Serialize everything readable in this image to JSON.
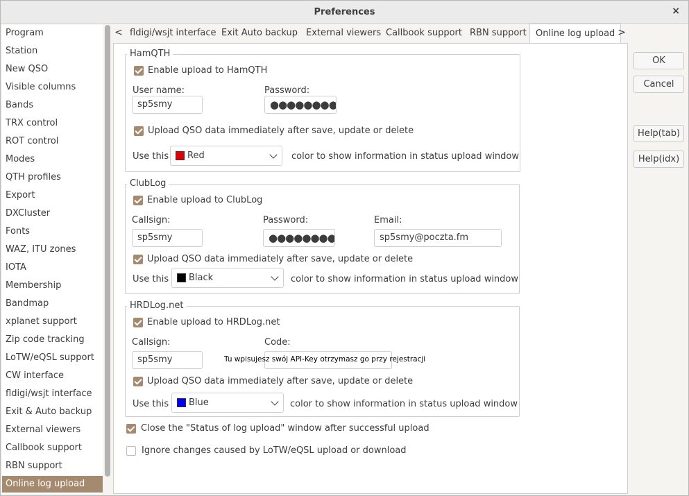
{
  "window": {
    "title": "Preferences",
    "close_glyph": "×"
  },
  "sidebar": {
    "items": [
      {
        "label": "Program"
      },
      {
        "label": "Station"
      },
      {
        "label": "New QSO"
      },
      {
        "label": "Visible columns"
      },
      {
        "label": "Bands"
      },
      {
        "label": "TRX control"
      },
      {
        "label": "ROT control"
      },
      {
        "label": "Modes"
      },
      {
        "label": "QTH profiles"
      },
      {
        "label": "Export"
      },
      {
        "label": "DXCluster"
      },
      {
        "label": "Fonts"
      },
      {
        "label": "WAZ, ITU zones"
      },
      {
        "label": "IOTA"
      },
      {
        "label": "Membership"
      },
      {
        "label": "Bandmap"
      },
      {
        "label": "xplanet support"
      },
      {
        "label": "Zip code tracking"
      },
      {
        "label": "LoTW/eQSL support"
      },
      {
        "label": "CW interface"
      },
      {
        "label": "fldigi/wsjt interface"
      },
      {
        "label": "Exit & Auto backup"
      },
      {
        "label": "External viewers"
      },
      {
        "label": "Callbook support"
      },
      {
        "label": "RBN support"
      },
      {
        "label": "Online log upload"
      }
    ],
    "selected": "Online log upload"
  },
  "tabs": {
    "left_arrow": "<",
    "right_arrow": ">",
    "items": [
      "fldigi/wsjt interface",
      "Exit  Auto backup",
      "External viewers",
      "Callbook support",
      "RBN support",
      "Online log upload"
    ],
    "active": "Online log upload"
  },
  "hamqth": {
    "title": "HamQTH",
    "enable_label": "Enable upload to HamQTH",
    "enable_checked": true,
    "username_label": "User name:",
    "username_value": "sp5smy",
    "password_label": "Password:",
    "password_value": "●●●●●●●●",
    "immediate_label": "Upload QSO data immediately after save, update or delete",
    "immediate_checked": true,
    "use_this": "Use this",
    "color_name": "Red",
    "color_hex": "#e00000",
    "color_suffix": "color to show information in status upload window"
  },
  "clublog": {
    "title": "ClubLog",
    "enable_label": "Enable upload to ClubLog",
    "enable_checked": true,
    "callsign_label": "Callsign:",
    "callsign_value": "sp5smy",
    "password_label": "Password:",
    "password_value": "●●●●●●●●",
    "email_label": "Email:",
    "email_value": "sp5smy@poczta.fm",
    "immediate_label": "Upload QSO data immediately after save, update or delete",
    "immediate_checked": true,
    "use_this": "Use this",
    "color_name": "Black",
    "color_hex": "#000000",
    "color_suffix": "color to show information in status upload window"
  },
  "hrdlog": {
    "title": "HRDLog.net",
    "enable_label": "Enable upload to HRDLog.net",
    "enable_checked": true,
    "callsign_label": "Callsign:",
    "callsign_value": "sp5smy",
    "code_label": "Code:",
    "code_hint": "Tu wpisujesz swój API-Key otrzymasz go przy rejestracji",
    "immediate_label": "Upload QSO data immediately after save, update or delete",
    "immediate_checked": true,
    "use_this": "Use this",
    "color_name": "Blue",
    "color_hex": "#0000ee",
    "color_suffix": "color to show information in status upload window"
  },
  "options": {
    "close_status_label": "Close the \"Status of log upload\" window after successful upload",
    "close_status_checked": true,
    "ignore_label": "Ignore changes caused by LoTW/eQSL upload or download",
    "ignore_checked": false
  },
  "buttons": {
    "ok": "OK",
    "cancel": "Cancel",
    "help_tab": "Help(tab)",
    "help_idx": "Help(idx)"
  }
}
